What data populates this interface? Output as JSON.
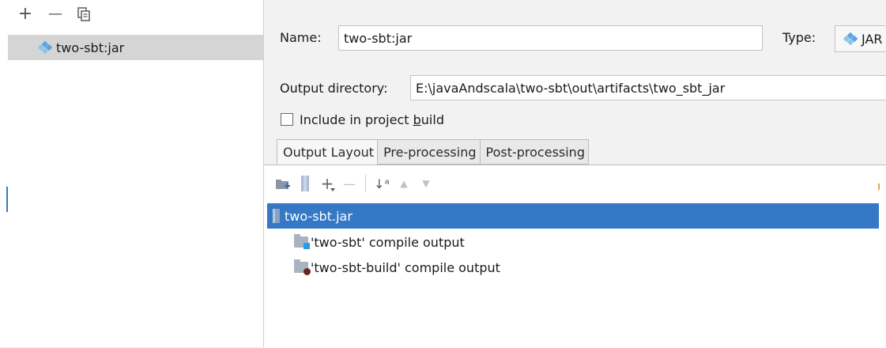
{
  "left": {
    "toolbar": {
      "add": "+",
      "remove": "—"
    },
    "items": [
      {
        "label": "two-sbt:jar"
      }
    ]
  },
  "form": {
    "name_label": "Name:",
    "name_value": "two-sbt:jar",
    "type_label": "Type:",
    "type_value": "JAR",
    "output_label": "Output directory:",
    "output_value": "E:\\javaAndscala\\two-sbt\\out\\artifacts\\two_sbt_jar",
    "include_label_pre": "Include in project ",
    "include_label_mnemonic": "b",
    "include_label_post": "uild",
    "include_checked": false
  },
  "tabs": [
    {
      "label": "Output Layout",
      "active": true
    },
    {
      "label": "Pre-processing",
      "active": false
    },
    {
      "label": "Post-processing",
      "active": false
    }
  ],
  "layout": {
    "toolbar": {
      "add": "+",
      "remove": "—",
      "sort": "↓ᵃ",
      "up": "▲",
      "down": "▼"
    },
    "root": {
      "label": "two-sbt.jar"
    },
    "children": [
      {
        "label": "'two-sbt' compile output"
      },
      {
        "label": "'two-sbt-build' compile output"
      }
    ]
  },
  "colors": {
    "selection": "#3478c6",
    "tree_selection": "#d5d5d5"
  }
}
